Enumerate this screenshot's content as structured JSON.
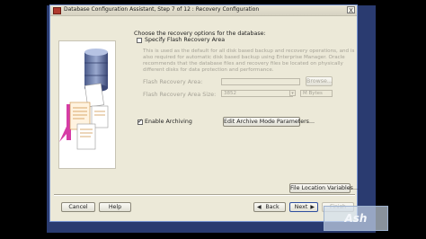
{
  "window": {
    "title": "Database Configuration Assistant, Step 7 of 12 : Recovery Configuration",
    "close_glyph": "X"
  },
  "content": {
    "instruction": "Choose the recovery options for the database:",
    "flash_checkbox_label": "Specify Flash Recovery Area",
    "flash_checked": false,
    "description": "This is used as the default for all disk based backup and recovery operations, and is also required for automatic disk based backup using Enterprise Manager. Oracle recommends that the database files and recovery files be located on physically different disks for data protection and performance.",
    "flash_area_label": "Flash Recovery Area:",
    "flash_area_value": "",
    "browse_label": "Browse...",
    "flash_size_label": "Flash Recovery Area Size:",
    "flash_size_value": "3852",
    "size_unit": "M Bytes",
    "archiving_label": "Enable Archiving",
    "archiving_checked": true,
    "edit_archive_label": "Edit Archive Mode Parameters...",
    "file_location_label": "File Location Variables..."
  },
  "footer": {
    "cancel": "Cancel",
    "help": "Help",
    "back": "Back",
    "next": "Next",
    "finish": "Finish"
  },
  "watermark": "Ash"
}
